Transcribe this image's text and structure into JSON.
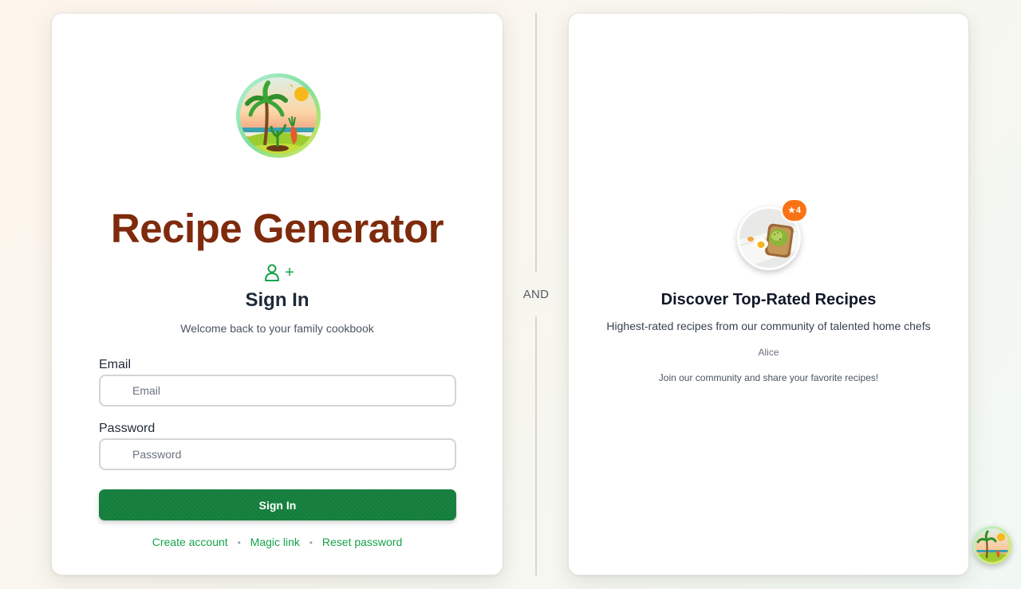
{
  "app": {
    "title": "Recipe Generator"
  },
  "signin": {
    "heading": "Sign In",
    "subtitle": "Welcome back to your family cookbook",
    "add_symbol": "+",
    "email_label": "Email",
    "email_placeholder": "Email",
    "email_value": "",
    "password_label": "Password",
    "password_placeholder": "Password",
    "password_value": "",
    "submit_label": "Sign In",
    "links": {
      "create_account": "Create account",
      "magic_link": "Magic link",
      "reset_password": "Reset password"
    },
    "separator": "•"
  },
  "divider": {
    "label": "AND"
  },
  "featured": {
    "rating": "4",
    "title": "Discover Top-Rated Recipes",
    "subtitle": "Highest-rated recipes from our community of talented home chefs",
    "author": "Alice",
    "cta_text": "Join our community and share your favorite recipes!"
  },
  "icons": {
    "logo": "island-garden-logo-icon",
    "user_add": "user-plus-icon",
    "star": "star-icon",
    "fab": "island-garden-logo-icon"
  },
  "colors": {
    "title": "#7e2a0c",
    "accent_green": "#16a34a",
    "button_green": "#15803d",
    "badge_orange": "#f97316"
  }
}
